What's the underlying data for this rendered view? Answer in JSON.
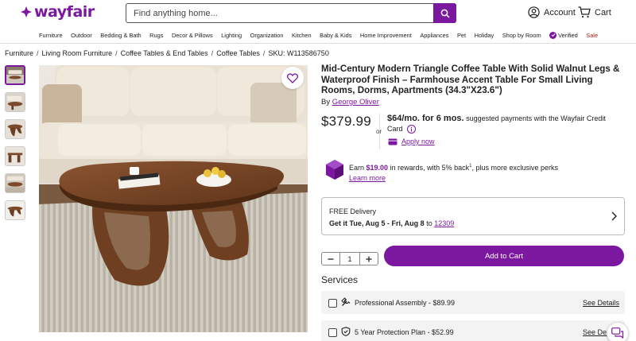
{
  "brand": {
    "name": "wayfair",
    "color": "#7b189f"
  },
  "search": {
    "placeholder": "Find anything home..."
  },
  "header": {
    "account_label": "Account",
    "cart_label": "Cart"
  },
  "nav": {
    "items": [
      "Furniture",
      "Outdoor",
      "Bedding & Bath",
      "Rugs",
      "Decor & Pillows",
      "Lighting",
      "Organization",
      "Kitchen",
      "Baby & Kids",
      "Home Improvement",
      "Appliances",
      "Pet",
      "Holiday",
      "Shop by Room"
    ],
    "verified": "Verified",
    "sale": "Sale"
  },
  "breadcrumb": [
    "Furniture",
    "Living Room Furniture",
    "Coffee Tables & End Tables",
    "Coffee Tables"
  ],
  "sku": "SKU: W113586750",
  "product": {
    "title": "Mid-Century Modern Triangle Coffee Table With Solid Walnut Legs & Waterproof Finish – Farmhouse Accent Table For Small Living Rooms, Dorms, Apartments (34.3\"X23.6\")",
    "by_prefix": "By",
    "brand_name": "George Oliver",
    "price": "$379.99",
    "or": "or",
    "monthly": "$64/mo. for 6 mos.",
    "financing_text": "suggested payments with the Wayfair Credit Card",
    "apply_label": "Apply now"
  },
  "rewards": {
    "earn": "Earn",
    "amount": "$19.00",
    "text": "in rewards, with 5% back",
    "sup": "1",
    "tail": ", plus more exclusive perks",
    "link": "Learn more"
  },
  "delivery": {
    "title": "FREE Delivery",
    "date_prefix": "Get it Tue, Aug 5 - Fri, Aug 8",
    "to": "to",
    "zip": "12309"
  },
  "cart": {
    "quantity": "1",
    "add_label": "Add to Cart"
  },
  "services": {
    "title": "Services",
    "items": [
      {
        "label": "Professional Assembly - $89.99",
        "link": "See Details"
      },
      {
        "label": "5 Year Protection Plan - $52.99",
        "link": "See Details"
      }
    ]
  },
  "thumbnails_count": 6
}
